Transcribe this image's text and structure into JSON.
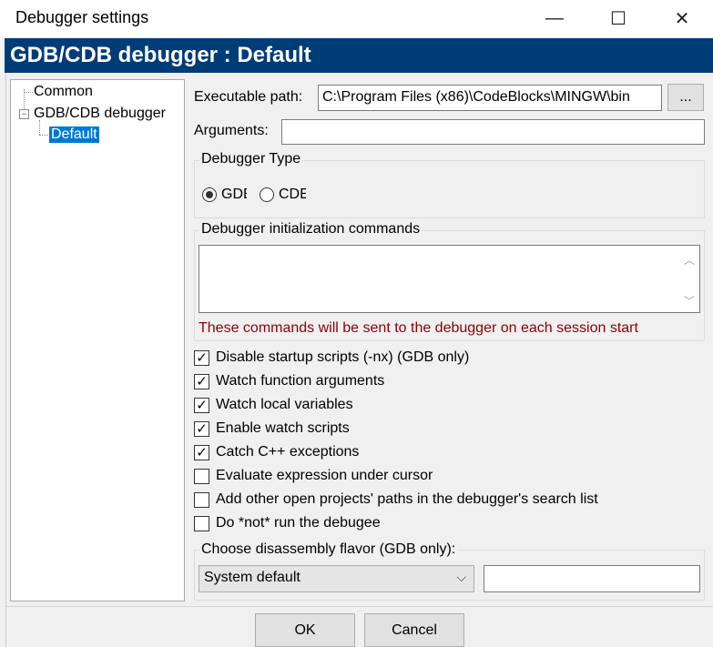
{
  "window": {
    "title": "Debugger settings",
    "minimize_glyph": "—",
    "maximize_glyph": "☐",
    "close_glyph": "✕"
  },
  "banner": {
    "title": "GDB/CDB debugger : Default"
  },
  "tree": {
    "items": [
      {
        "label": "Common"
      },
      {
        "label": "GDB/CDB debugger",
        "expander": "−"
      },
      {
        "label": "Default"
      }
    ]
  },
  "form": {
    "executable_path": {
      "label": "Executable path:",
      "value": "C:\\Program Files (x86)\\CodeBlocks\\MINGW\\bin",
      "browse_label": "..."
    },
    "arguments": {
      "label": "Arguments:",
      "value": ""
    },
    "debugger_type": {
      "title": "Debugger Type",
      "options": [
        {
          "label": "GDE",
          "selected": true
        },
        {
          "label": "CDE",
          "selected": false
        }
      ]
    },
    "init_commands": {
      "title": "Debugger initialization commands",
      "value": "",
      "note": "These commands will be sent to the debugger on each session start"
    },
    "checkboxes": [
      {
        "label": "Disable startup scripts (-nx) (GDB only)",
        "checked": true
      },
      {
        "label": "Watch function arguments",
        "checked": true
      },
      {
        "label": "Watch local variables",
        "checked": true
      },
      {
        "label": "Enable watch scripts",
        "checked": true
      },
      {
        "label": "Catch C++ exceptions",
        "checked": true
      },
      {
        "label": "Evaluate expression under cursor",
        "checked": false
      },
      {
        "label": "Add other open projects' paths in the debugger's search list",
        "checked": false
      },
      {
        "label": "Do *not* run the debugee",
        "checked": false
      }
    ],
    "disassembly": {
      "title": "Choose disassembly flavor (GDB only):",
      "selected": "System default",
      "extra_value": ""
    }
  },
  "buttons": {
    "ok": "OK",
    "cancel": "Cancel"
  },
  "icons": {
    "checkmark": "✓",
    "chevron_down": "⌵",
    "scroll_up": "︿",
    "scroll_down": "﹀"
  },
  "colors": {
    "banner_bg": "#003c78",
    "selection_bg": "#0078d7",
    "note_text": "#8b0000"
  }
}
